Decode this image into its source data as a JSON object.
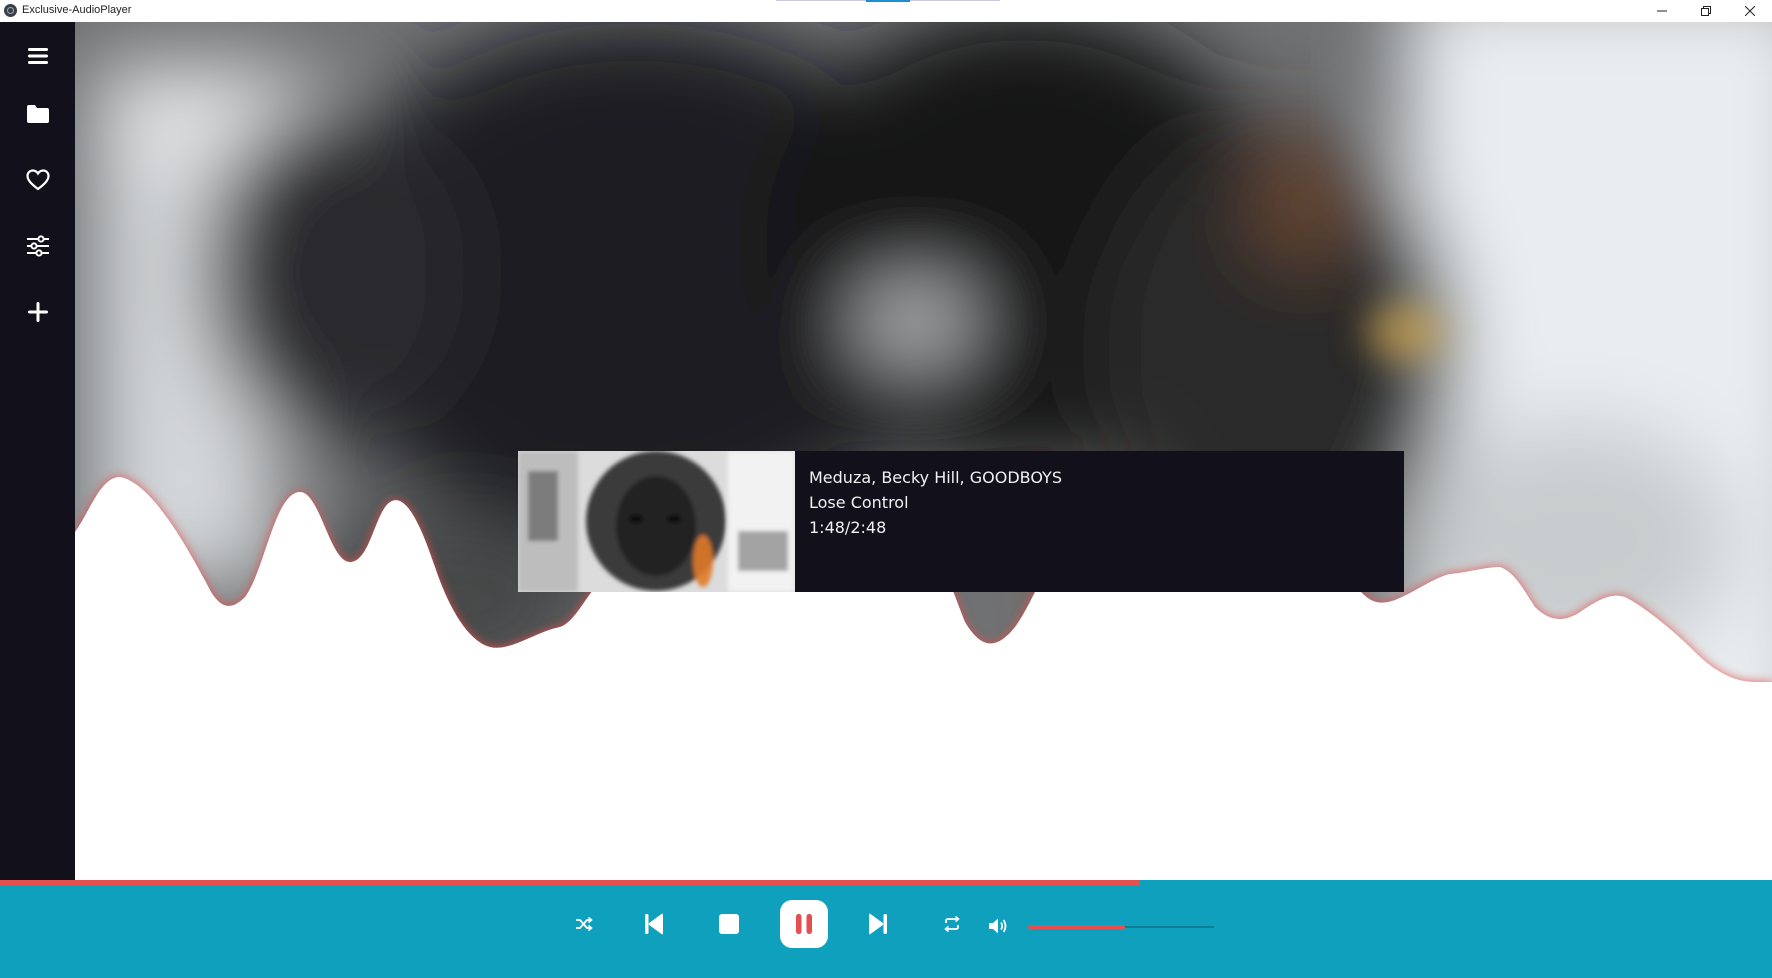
{
  "window": {
    "title": "Exclusive-AudioPlayer",
    "minimize_icon": "minimize-icon",
    "restore_icon": "restore-icon",
    "close_icon": "close-icon"
  },
  "sidebar": {
    "items": [
      {
        "name": "menu",
        "icon": "hamburger-menu-icon"
      },
      {
        "name": "library",
        "icon": "folder-icon"
      },
      {
        "name": "favorites",
        "icon": "heart-icon"
      },
      {
        "name": "equalizer",
        "icon": "sliders-icon"
      },
      {
        "name": "add",
        "icon": "plus-icon"
      }
    ]
  },
  "now_playing": {
    "artist": "Meduza, Becky Hill, GOODBOYS",
    "title": "Lose Control",
    "time": "1:48/2:48"
  },
  "playback": {
    "progress_fraction": 0.643,
    "volume_fraction": 0.52
  },
  "controls": {
    "shuffle": "shuffle-icon",
    "previous": "skip-previous-icon",
    "stop": "stop-icon",
    "pause": "pause-icon",
    "next": "skip-next-icon",
    "repeat": "repeat-icon",
    "volume": "volume-icon"
  },
  "colors": {
    "sidebar": "#12111b",
    "player_bar": "#0ea0bd",
    "accent": "#e45050",
    "card": "#12111b"
  }
}
